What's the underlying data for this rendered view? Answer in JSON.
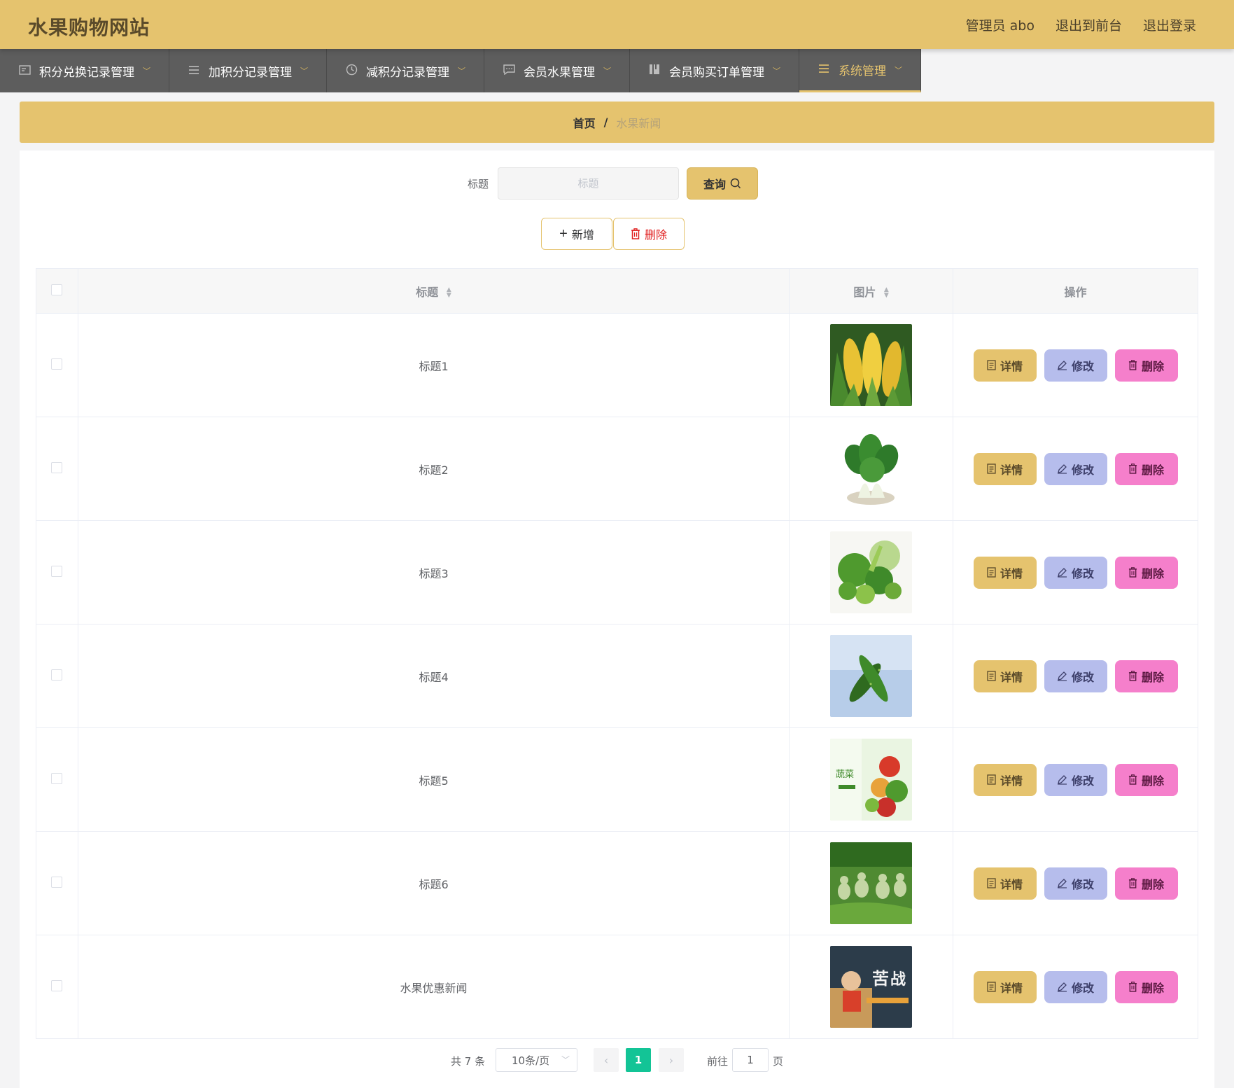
{
  "header": {
    "site_title": "水果购物网站",
    "admin_label": "管理员 abo",
    "back_to_front": "退出到前台",
    "logout": "退出登录",
    "bg_color": "#e5c36e"
  },
  "nav": {
    "items": [
      {
        "label": "积分兑换记录管理",
        "icon": "card-icon"
      },
      {
        "label": "加积分记录管理",
        "icon": "list-icon"
      },
      {
        "label": "减积分记录管理",
        "icon": "clock-icon"
      },
      {
        "label": "会员水果管理",
        "icon": "message-icon"
      },
      {
        "label": "会员购买订单管理",
        "icon": "book-icon"
      },
      {
        "label": "系统管理",
        "icon": "list-icon",
        "active": true
      }
    ]
  },
  "breadcrumb": {
    "home": "首页",
    "separator": "/",
    "current": "水果新闻"
  },
  "search": {
    "label": "标题",
    "placeholder": "标题",
    "value": "",
    "button": "查询"
  },
  "actions": {
    "add": "新增",
    "delete": "删除"
  },
  "table": {
    "columns": {
      "title": "标题",
      "image": "图片",
      "operations": "操作"
    },
    "row_buttons": {
      "detail": "详情",
      "edit": "修改",
      "delete": "删除"
    },
    "rows": [
      {
        "title": "标题1",
        "image": "corn"
      },
      {
        "title": "标题2",
        "image": "bok-choy"
      },
      {
        "title": "标题3",
        "image": "mixed-vegetables"
      },
      {
        "title": "标题4",
        "image": "cucumber"
      },
      {
        "title": "标题5",
        "image": "vegetable-poster"
      },
      {
        "title": "标题6",
        "image": "gourds"
      },
      {
        "title": "水果优惠新闻",
        "image": "exam-poster"
      }
    ]
  },
  "pagination": {
    "total": "共 7 条",
    "page_size": "10条/页",
    "current_page": "1",
    "goto_label": "前往",
    "goto_value": "1",
    "goto_unit": "页"
  },
  "colors": {
    "accent": "#e5c36e",
    "nav_bg": "#5d5d5d",
    "edit_btn": "#b6bdec",
    "delete_btn": "#f57fcb",
    "page_active": "#13c496"
  }
}
